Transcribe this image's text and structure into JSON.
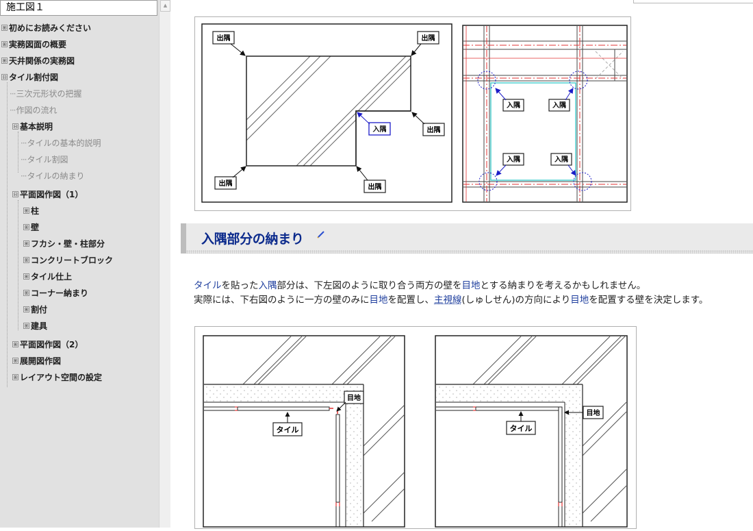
{
  "sidebar": {
    "title": "施工図１",
    "items": [
      {
        "label": "初めにお読みください",
        "expander": "⊞"
      },
      {
        "label": "実務図面の概要",
        "expander": "⊞"
      },
      {
        "label": "天井関係の実務図",
        "expander": "⊞"
      },
      {
        "label": "タイル割付図",
        "expander": "⊟"
      },
      {
        "label": "三次元形状の把握"
      },
      {
        "label": "作図の流れ"
      },
      {
        "label": "基本説明",
        "expander": "⊟"
      },
      {
        "label": "タイルの基本的説明"
      },
      {
        "label": "タイル割図"
      },
      {
        "label": "タイルの納まり"
      },
      {
        "label": "平面図作図（1）",
        "expander": "⊟"
      },
      {
        "label": "柱",
        "expander": "⊞"
      },
      {
        "label": "壁",
        "expander": "⊞"
      },
      {
        "label": "フカシ・壁・柱部分",
        "expander": "⊞"
      },
      {
        "label": "コンクリートブロック",
        "expander": "⊞"
      },
      {
        "label": "タイル仕上",
        "expander": "⊞"
      },
      {
        "label": "コーナー納まり",
        "expander": "⊞"
      },
      {
        "label": "割付",
        "expander": "⊞"
      },
      {
        "label": "建具",
        "expander": "⊞"
      },
      {
        "label": "平面図作図（2）",
        "expander": "⊞"
      },
      {
        "label": "展開図作図",
        "expander": "⊞"
      },
      {
        "label": "レイアウト空間の設定",
        "expander": "⊞"
      }
    ]
  },
  "scroll_up_glyph": "▲",
  "figure1": {
    "left_labels": {
      "top_left": "出隅",
      "top_right": "出隅",
      "mid_right": "出隅",
      "inner": "入隅",
      "bottom_left": "出隅",
      "bottom_right": "出隅"
    },
    "right_labels": {
      "top_left": "入隅",
      "top_right": "入隅",
      "bottom_left": "入隅",
      "bottom_right": "入隅"
    }
  },
  "section": {
    "title": "入隅部分の納まり",
    "edit_icon": "pencil-icon"
  },
  "paragraph": {
    "line1": [
      {
        "t": "タイル",
        "link": true
      },
      {
        "t": "を貼った"
      },
      {
        "t": "入隅",
        "link": true
      },
      {
        "t": "部分は、下左図のように取り合う両方の壁を"
      },
      {
        "t": "目地",
        "link": true
      },
      {
        "t": "とする納まりを考えるかもしれません。"
      }
    ],
    "line2": [
      {
        "t": "実際には、下右図のように一方の壁のみに"
      },
      {
        "t": "目地",
        "link": true
      },
      {
        "t": "を配置し、"
      },
      {
        "t": "主視線",
        "link": true,
        "ul": true
      },
      {
        "t": "(しゅしせん)の方向により"
      },
      {
        "t": "目地",
        "link": true
      },
      {
        "t": "を配置する壁を決定します。"
      }
    ]
  },
  "figure2": {
    "left": {
      "tile_label": "タイル",
      "joint_label": "目地"
    },
    "right": {
      "tile_label": "タイル",
      "joint_label": "目地"
    }
  },
  "colors": {
    "link": "#1f3f9e",
    "heading": "#0b2a8c",
    "callout_blue": "#1c1cc8",
    "guide_red": "#e23030",
    "tile_cyan": "#33c9c9"
  }
}
